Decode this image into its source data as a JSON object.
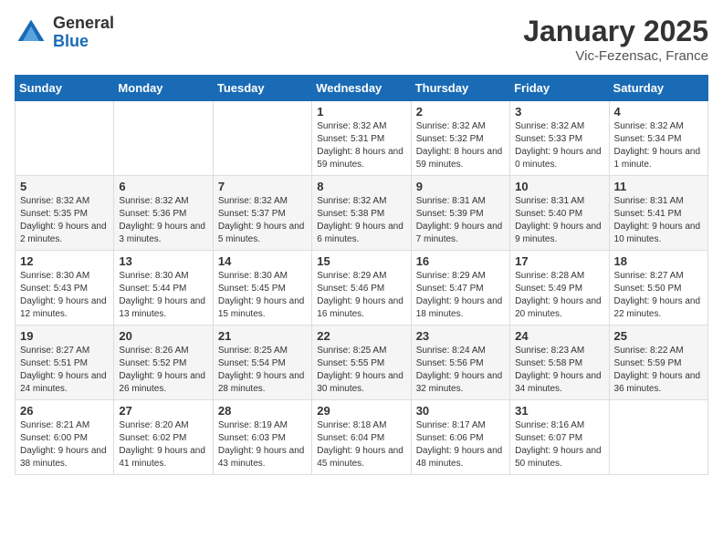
{
  "header": {
    "logo_general": "General",
    "logo_blue": "Blue",
    "month_title": "January 2025",
    "subtitle": "Vic-Fezensac, France"
  },
  "days_of_week": [
    "Sunday",
    "Monday",
    "Tuesday",
    "Wednesday",
    "Thursday",
    "Friday",
    "Saturday"
  ],
  "weeks": [
    [
      {
        "day": "",
        "sunrise": "",
        "sunset": "",
        "daylight": ""
      },
      {
        "day": "",
        "sunrise": "",
        "sunset": "",
        "daylight": ""
      },
      {
        "day": "",
        "sunrise": "",
        "sunset": "",
        "daylight": ""
      },
      {
        "day": "1",
        "sunrise": "Sunrise: 8:32 AM",
        "sunset": "Sunset: 5:31 PM",
        "daylight": "Daylight: 8 hours and 59 minutes."
      },
      {
        "day": "2",
        "sunrise": "Sunrise: 8:32 AM",
        "sunset": "Sunset: 5:32 PM",
        "daylight": "Daylight: 8 hours and 59 minutes."
      },
      {
        "day": "3",
        "sunrise": "Sunrise: 8:32 AM",
        "sunset": "Sunset: 5:33 PM",
        "daylight": "Daylight: 9 hours and 0 minutes."
      },
      {
        "day": "4",
        "sunrise": "Sunrise: 8:32 AM",
        "sunset": "Sunset: 5:34 PM",
        "daylight": "Daylight: 9 hours and 1 minute."
      }
    ],
    [
      {
        "day": "5",
        "sunrise": "Sunrise: 8:32 AM",
        "sunset": "Sunset: 5:35 PM",
        "daylight": "Daylight: 9 hours and 2 minutes."
      },
      {
        "day": "6",
        "sunrise": "Sunrise: 8:32 AM",
        "sunset": "Sunset: 5:36 PM",
        "daylight": "Daylight: 9 hours and 3 minutes."
      },
      {
        "day": "7",
        "sunrise": "Sunrise: 8:32 AM",
        "sunset": "Sunset: 5:37 PM",
        "daylight": "Daylight: 9 hours and 5 minutes."
      },
      {
        "day": "8",
        "sunrise": "Sunrise: 8:32 AM",
        "sunset": "Sunset: 5:38 PM",
        "daylight": "Daylight: 9 hours and 6 minutes."
      },
      {
        "day": "9",
        "sunrise": "Sunrise: 8:31 AM",
        "sunset": "Sunset: 5:39 PM",
        "daylight": "Daylight: 9 hours and 7 minutes."
      },
      {
        "day": "10",
        "sunrise": "Sunrise: 8:31 AM",
        "sunset": "Sunset: 5:40 PM",
        "daylight": "Daylight: 9 hours and 9 minutes."
      },
      {
        "day": "11",
        "sunrise": "Sunrise: 8:31 AM",
        "sunset": "Sunset: 5:41 PM",
        "daylight": "Daylight: 9 hours and 10 minutes."
      }
    ],
    [
      {
        "day": "12",
        "sunrise": "Sunrise: 8:30 AM",
        "sunset": "Sunset: 5:43 PM",
        "daylight": "Daylight: 9 hours and 12 minutes."
      },
      {
        "day": "13",
        "sunrise": "Sunrise: 8:30 AM",
        "sunset": "Sunset: 5:44 PM",
        "daylight": "Daylight: 9 hours and 13 minutes."
      },
      {
        "day": "14",
        "sunrise": "Sunrise: 8:30 AM",
        "sunset": "Sunset: 5:45 PM",
        "daylight": "Daylight: 9 hours and 15 minutes."
      },
      {
        "day": "15",
        "sunrise": "Sunrise: 8:29 AM",
        "sunset": "Sunset: 5:46 PM",
        "daylight": "Daylight: 9 hours and 16 minutes."
      },
      {
        "day": "16",
        "sunrise": "Sunrise: 8:29 AM",
        "sunset": "Sunset: 5:47 PM",
        "daylight": "Daylight: 9 hours and 18 minutes."
      },
      {
        "day": "17",
        "sunrise": "Sunrise: 8:28 AM",
        "sunset": "Sunset: 5:49 PM",
        "daylight": "Daylight: 9 hours and 20 minutes."
      },
      {
        "day": "18",
        "sunrise": "Sunrise: 8:27 AM",
        "sunset": "Sunset: 5:50 PM",
        "daylight": "Daylight: 9 hours and 22 minutes."
      }
    ],
    [
      {
        "day": "19",
        "sunrise": "Sunrise: 8:27 AM",
        "sunset": "Sunset: 5:51 PM",
        "daylight": "Daylight: 9 hours and 24 minutes."
      },
      {
        "day": "20",
        "sunrise": "Sunrise: 8:26 AM",
        "sunset": "Sunset: 5:52 PM",
        "daylight": "Daylight: 9 hours and 26 minutes."
      },
      {
        "day": "21",
        "sunrise": "Sunrise: 8:25 AM",
        "sunset": "Sunset: 5:54 PM",
        "daylight": "Daylight: 9 hours and 28 minutes."
      },
      {
        "day": "22",
        "sunrise": "Sunrise: 8:25 AM",
        "sunset": "Sunset: 5:55 PM",
        "daylight": "Daylight: 9 hours and 30 minutes."
      },
      {
        "day": "23",
        "sunrise": "Sunrise: 8:24 AM",
        "sunset": "Sunset: 5:56 PM",
        "daylight": "Daylight: 9 hours and 32 minutes."
      },
      {
        "day": "24",
        "sunrise": "Sunrise: 8:23 AM",
        "sunset": "Sunset: 5:58 PM",
        "daylight": "Daylight: 9 hours and 34 minutes."
      },
      {
        "day": "25",
        "sunrise": "Sunrise: 8:22 AM",
        "sunset": "Sunset: 5:59 PM",
        "daylight": "Daylight: 9 hours and 36 minutes."
      }
    ],
    [
      {
        "day": "26",
        "sunrise": "Sunrise: 8:21 AM",
        "sunset": "Sunset: 6:00 PM",
        "daylight": "Daylight: 9 hours and 38 minutes."
      },
      {
        "day": "27",
        "sunrise": "Sunrise: 8:20 AM",
        "sunset": "Sunset: 6:02 PM",
        "daylight": "Daylight: 9 hours and 41 minutes."
      },
      {
        "day": "28",
        "sunrise": "Sunrise: 8:19 AM",
        "sunset": "Sunset: 6:03 PM",
        "daylight": "Daylight: 9 hours and 43 minutes."
      },
      {
        "day": "29",
        "sunrise": "Sunrise: 8:18 AM",
        "sunset": "Sunset: 6:04 PM",
        "daylight": "Daylight: 9 hours and 45 minutes."
      },
      {
        "day": "30",
        "sunrise": "Sunrise: 8:17 AM",
        "sunset": "Sunset: 6:06 PM",
        "daylight": "Daylight: 9 hours and 48 minutes."
      },
      {
        "day": "31",
        "sunrise": "Sunrise: 8:16 AM",
        "sunset": "Sunset: 6:07 PM",
        "daylight": "Daylight: 9 hours and 50 minutes."
      },
      {
        "day": "",
        "sunrise": "",
        "sunset": "",
        "daylight": ""
      }
    ]
  ]
}
